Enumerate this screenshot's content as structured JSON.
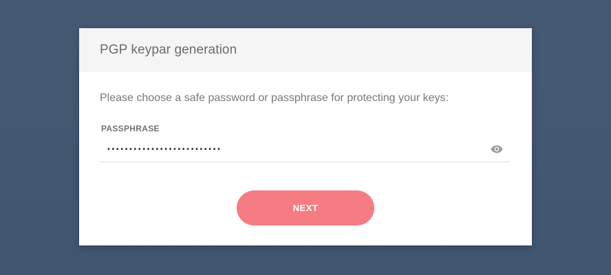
{
  "dialog": {
    "title": "PGP keypar generation",
    "instruction": "Please choose a safe password or passphrase for protecting your keys:",
    "passphrase": {
      "label": "PASSPHRASE",
      "value": "••••••••••••••••••••••••••",
      "toggle_icon": "eye-icon"
    },
    "next_label": "NEXT"
  },
  "colors": {
    "background": "#435870",
    "header_background": "#f5f5f5",
    "accent": "#f47c82"
  }
}
